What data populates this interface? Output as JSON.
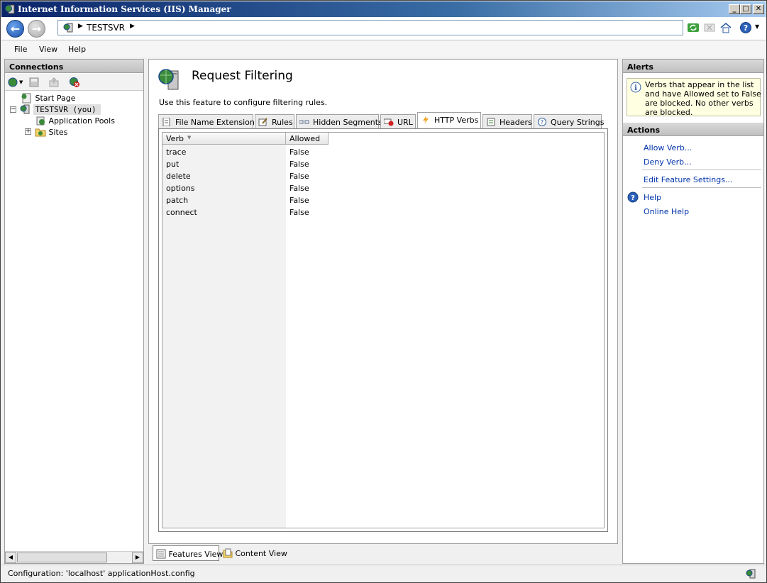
{
  "window": {
    "title": "Internet Information Services (IIS) Manager"
  },
  "address": {
    "crumbs": [
      "TESTSVR"
    ]
  },
  "menu": [
    "File",
    "View",
    "Help"
  ],
  "connections": {
    "header": "Connections",
    "tree": [
      {
        "label": "Start Page"
      },
      {
        "label": "TESTSVR (you)"
      },
      {
        "label": "Application Pools"
      },
      {
        "label": "Sites"
      }
    ]
  },
  "feature": {
    "title": "Request Filtering",
    "description": "Use this feature to configure filtering rules.",
    "tabs": [
      "File Name Extensions",
      "Rules",
      "Hidden Segments",
      "URL",
      "HTTP Verbs",
      "Headers",
      "Query Strings"
    ],
    "active_tab": "HTTP Verbs",
    "columns": [
      "Verb",
      "Allowed"
    ],
    "rows": [
      {
        "verb": "trace",
        "allowed": "False"
      },
      {
        "verb": "put",
        "allowed": "False"
      },
      {
        "verb": "delete",
        "allowed": "False"
      },
      {
        "verb": "options",
        "allowed": "False"
      },
      {
        "verb": "patch",
        "allowed": "False"
      },
      {
        "verb": "connect",
        "allowed": "False"
      }
    ]
  },
  "views": {
    "features": "Features View",
    "content": "Content View"
  },
  "alerts": {
    "header": "Alerts",
    "message": "Verbs that appear in the list and have Allowed set to False are blocked. No other verbs are blocked."
  },
  "actions": {
    "header": "Actions",
    "allow": "Allow Verb...",
    "deny": "Deny Verb...",
    "edit_settings": "Edit Feature Settings...",
    "help": "Help",
    "online_help": "Online Help"
  },
  "status": {
    "text": "Configuration: 'localhost' applicationHost.config"
  }
}
